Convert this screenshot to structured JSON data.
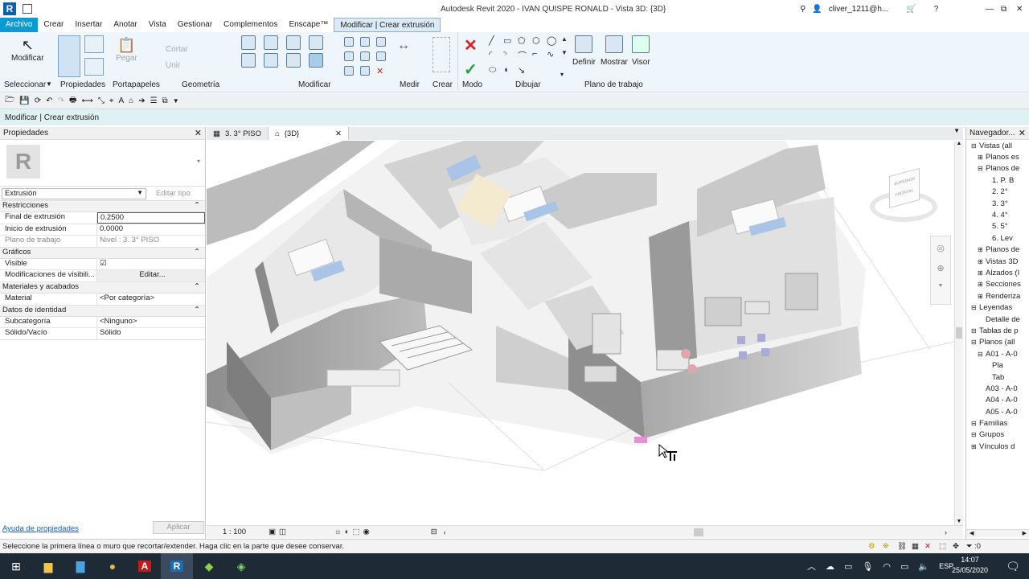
{
  "title_bar": {
    "app_logo": "R",
    "title": "Autodesk Revit 2020 - IVAN QUISPE RONALD - Vista 3D: {3D}",
    "user": "cliver_1211@h...",
    "minimize": "—",
    "restore": "⧉",
    "close": "✕"
  },
  "menu_tabs": [
    "Archivo",
    "Crear",
    "Insertar",
    "Anotar",
    "Vista",
    "Gestionar",
    "Complementos",
    "Enscape™",
    "Modificar | Crear extrusión"
  ],
  "ribbon": {
    "modify_label": "Modificar",
    "select_label": "Seleccionar",
    "properties_label": "Propiedades",
    "clipboard_label": "Portapapeles",
    "paste_label": "Pegar",
    "cut_label": "Cortar",
    "join_label": "Unir",
    "geometry_label": "Geometría",
    "modify_panel_label": "Modificar",
    "measure_label": "Medir",
    "create_label": "Crear",
    "mode_label": "Modo",
    "draw_label": "Dibujar",
    "define_label": "Definir",
    "show_label": "Mostrar",
    "viewer_label": "Visor",
    "workplane_label": "Plano de trabajo"
  },
  "options_bar": {
    "text": "Modificar | Crear extrusión"
  },
  "properties": {
    "header": "Propiedades",
    "type_selector": "Extrusión",
    "edit_type": "Editar tipo",
    "groups": [
      {
        "name": "Restricciones",
        "rows": [
          {
            "key": "Final de extrusión",
            "value": "0.2500"
          },
          {
            "key": "Inicio de extrusión",
            "value": "0.0000"
          },
          {
            "key": "Plano de trabajo",
            "value": "Nivel : 3. 3° PISO"
          }
        ]
      },
      {
        "name": "Gráficos",
        "rows": [
          {
            "key": "Visible",
            "value": "☑"
          },
          {
            "key": "Modificaciones de visibili...",
            "value": "Editar..."
          }
        ]
      },
      {
        "name": "Materiales y acabados",
        "rows": [
          {
            "key": "Material",
            "value": "<Por categoría>"
          }
        ]
      },
      {
        "name": "Datos de identidad",
        "rows": [
          {
            "key": "Subcategoría",
            "value": "<Ninguno>"
          },
          {
            "key": "Sólido/Vacío",
            "value": "Sólido"
          }
        ]
      }
    ],
    "help_link": "Ayuda de propiedades",
    "apply": "Aplicar"
  },
  "view_tabs": [
    {
      "label": "3. 3° PISO"
    },
    {
      "label": "{3D}"
    }
  ],
  "view_scale": "1 : 100",
  "navigator": {
    "header": "Navegador...",
    "items": [
      {
        "label": "Vistas (all"
      },
      {
        "label": "Planos es"
      },
      {
        "label": "Planos de"
      },
      {
        "label": "1. P. B"
      },
      {
        "label": "2. 2°"
      },
      {
        "label": "3. 3°"
      },
      {
        "label": "4. 4°"
      },
      {
        "label": "5. 5°"
      },
      {
        "label": "6. Lev"
      },
      {
        "label": "Planos de"
      },
      {
        "label": "Vistas 3D"
      },
      {
        "label": "Alzados (I"
      },
      {
        "label": "Secciones"
      },
      {
        "label": "Renderiza"
      },
      {
        "label": "Leyendas"
      },
      {
        "label": "Detalle de"
      },
      {
        "label": "Tablas de p"
      },
      {
        "label": "Planos (all"
      },
      {
        "label": "A01 - A-0"
      },
      {
        "label": "Pla"
      },
      {
        "label": "Tab"
      },
      {
        "label": "A03 - A-0"
      },
      {
        "label": "A04 - A-0"
      },
      {
        "label": "A05 - A-0"
      },
      {
        "label": "Familias"
      },
      {
        "label": "Grupos"
      },
      {
        "label": "Vínculos d"
      }
    ]
  },
  "viewcube": {
    "top": "SUPERIOR",
    "front": "FRONTAL"
  },
  "status_text": "Seleccione la primera línea o muro que recortar/extender. Haga clic en la parte que desee conservar.",
  "status_filter": ":0",
  "taskbar": {
    "lang": "ESP",
    "time": "14:07",
    "date": "25/05/2020"
  }
}
